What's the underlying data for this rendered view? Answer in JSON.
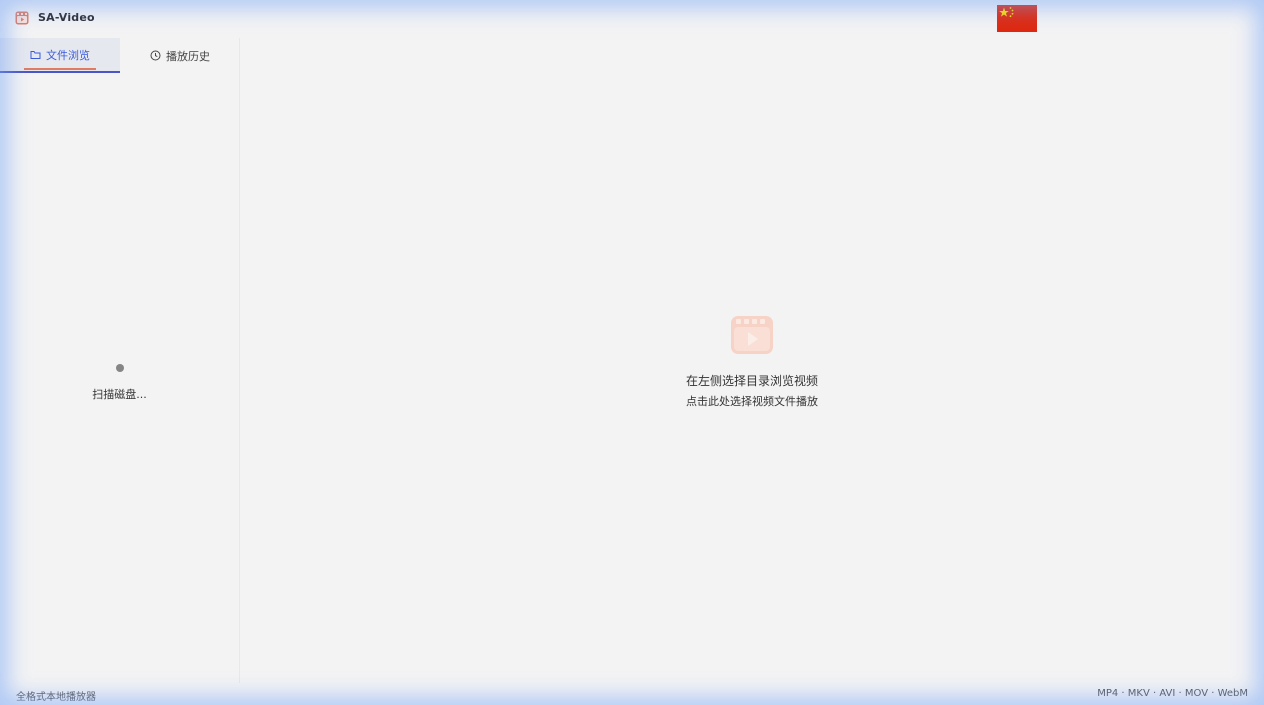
{
  "app": {
    "title": "SA-Video",
    "icon": "film-icon",
    "accent_color": "#e07b63"
  },
  "header": {
    "language_flag": "china-flag-icon"
  },
  "sidebar": {
    "tabs": [
      {
        "label": "文件浏览",
        "icon": "folder-icon",
        "active": true
      },
      {
        "label": "播放历史",
        "icon": "clock-icon",
        "active": false
      }
    ],
    "loading_text": "扫描磁盘..."
  },
  "main": {
    "empty_icon": "video-icon",
    "title": "在左侧选择目录浏览视频",
    "link": "点击此处选择视频文件播放"
  },
  "status": {
    "left": "全格式本地播放器",
    "right": "MP4 · MKV · AVI · MOV · WebM"
  }
}
